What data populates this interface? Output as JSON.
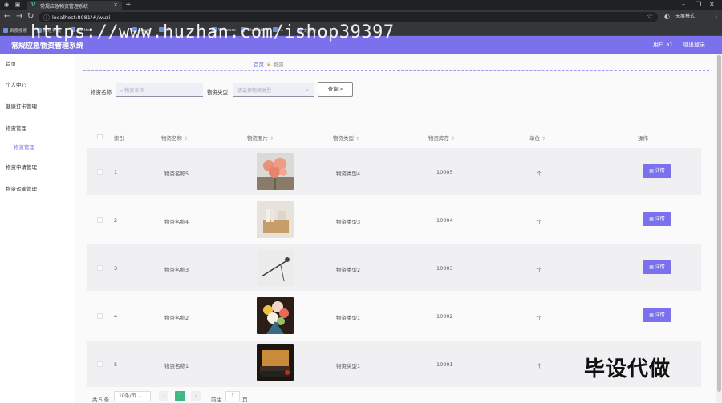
{
  "browser": {
    "tab_title": "常规应急物资管理系统",
    "url": "localhost:8081/#/wuzi",
    "profile_label": "无痕模式",
    "bookmarks": [
      "百度搜索",
      "网址导航",
      "Twitter",
      "Layui",
      "...",
      "VMware",
      "Website 7",
      "...",
      "文件夹"
    ],
    "watermark": "https://www.huzhan.com/ishop39397"
  },
  "header": {
    "app_title": "常规应急物资管理系统",
    "user_label": "用户 a1",
    "logout_label": "退出登录"
  },
  "sidebar": {
    "items": [
      {
        "label": "首页"
      },
      {
        "label": "个人中心"
      },
      {
        "label": "健康打卡管理"
      },
      {
        "label": "物资管理"
      },
      {
        "label": "物资管理"
      },
      {
        "label": "物资申请管理"
      },
      {
        "label": "物资运输管理"
      }
    ]
  },
  "breadcrumb": {
    "home": "首页",
    "current": "物资"
  },
  "filters": {
    "name_label": "物资名称",
    "name_placeholder": "物资名称",
    "type_label": "物资类型",
    "type_placeholder": "请选择物资类型",
    "query_label": "查询"
  },
  "table": {
    "headers": {
      "index": "索引",
      "name": "物资名称",
      "image": "物资图片",
      "type": "物资类型",
      "stock": "物资库存",
      "unit": "单位",
      "action": "操作"
    },
    "action_label": "详情",
    "rows": [
      {
        "index": "1",
        "name": "物资名称5",
        "type": "物资类型4",
        "stock": "10005",
        "unit": "个",
        "image": "flower-pink"
      },
      {
        "index": "2",
        "name": "物资名称4",
        "type": "物资类型3",
        "stock": "10004",
        "unit": "个",
        "image": "wooden-box"
      },
      {
        "index": "3",
        "name": "物资名称3",
        "type": "物资类型2",
        "stock": "10003",
        "unit": "个",
        "image": "single-flower"
      },
      {
        "index": "4",
        "name": "物资名称2",
        "type": "物资类型1",
        "stock": "10002",
        "unit": "个",
        "image": "bouquet"
      },
      {
        "index": "5",
        "name": "物资名称1",
        "type": "物资类型1",
        "stock": "10001",
        "unit": "个",
        "image": "laptop"
      }
    ]
  },
  "pagination": {
    "total": "共 5 条",
    "page_size": "10条/页",
    "current_page": "1",
    "goto_label": "前往",
    "goto_value": "1",
    "page_suffix": "页"
  },
  "overlay_stamp": "毕设代做"
}
